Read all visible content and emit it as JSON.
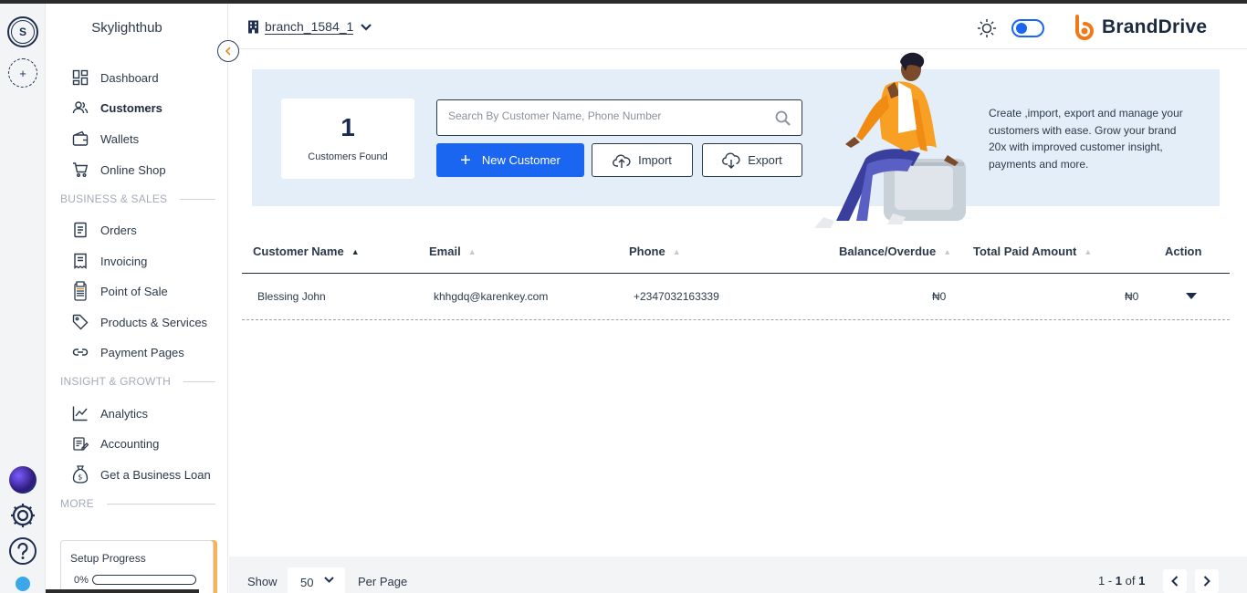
{
  "app": {
    "workspace_initial": "S",
    "workspace_name": "Skylighthub",
    "brand": "BrandDrive",
    "branch": "branch_1584_1"
  },
  "sidebar": {
    "items_top": [
      {
        "label": "Dashboard",
        "icon": "dashboard-icon"
      },
      {
        "label": "Customers",
        "icon": "customers-icon",
        "active": true
      },
      {
        "label": "Wallets",
        "icon": "wallet-icon"
      },
      {
        "label": "Online Shop",
        "icon": "cart-icon"
      }
    ],
    "section_business": "BUSINESS & SALES",
    "items_business": [
      {
        "label": "Orders",
        "icon": "orders-icon"
      },
      {
        "label": "Invoicing",
        "icon": "invoice-icon"
      },
      {
        "label": "Point of Sale",
        "icon": "pos-icon"
      },
      {
        "label": "Products & Services",
        "icon": "tag-icon"
      },
      {
        "label": "Payment Pages",
        "icon": "link-icon"
      }
    ],
    "section_insight": "INSIGHT & GROWTH",
    "items_insight": [
      {
        "label": "Analytics",
        "icon": "chart-icon"
      },
      {
        "label": "Accounting",
        "icon": "accounting-icon"
      },
      {
        "label": "Get a Business Loan",
        "icon": "money-bag-icon"
      }
    ],
    "section_more": "MORE",
    "setup_progress": {
      "title": "Setup Progress",
      "percent_label": "0%",
      "value": 0
    }
  },
  "hero": {
    "count": "1",
    "count_label": "Customers Found",
    "search_placeholder": "Search By Customer Name, Phone Number",
    "new_customer": "New Customer",
    "import": "Import",
    "export": "Export",
    "description": "Create ,import, export and manage your customers with ease. Grow your brand 20x with improved customer insight, payments and more."
  },
  "table": {
    "columns": [
      "Customer Name",
      "Email",
      "Phone",
      "Balance/Overdue",
      "Total Paid Amount",
      "Action"
    ],
    "rows": [
      {
        "name": "Blessing John",
        "email": "khhgdq@karenkey.com",
        "phone": "+2347032163339",
        "balance": "₦0",
        "paid": "₦0"
      }
    ]
  },
  "footer": {
    "show": "Show",
    "per_page_value": "50",
    "per_page": "Per Page",
    "range_prefix": "1 - ",
    "range_end": "1",
    "of": " of ",
    "total": "1"
  },
  "colors": {
    "accent": "#1a66f0",
    "hero_bg": "#e4eef9",
    "text": "#2b3a4a"
  }
}
